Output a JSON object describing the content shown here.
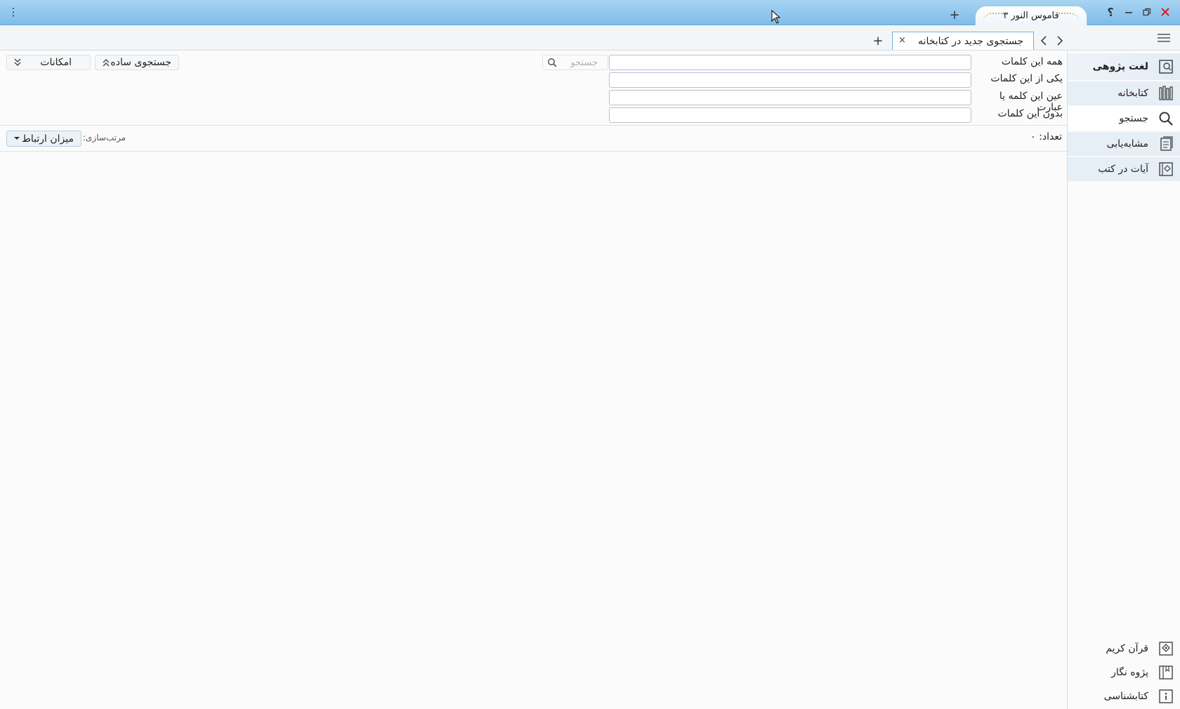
{
  "titlebar": {
    "app_tab_label": "قاموس النور ۳",
    "new_tab_symbol": "+",
    "help_symbol": "؟",
    "menu_symbol": "⋮"
  },
  "tabstrip": {
    "doc_tab_label": "جستجوی جدید در کتابخانه",
    "close_symbol": "×",
    "add_symbol": "+"
  },
  "sidebar": {
    "items": [
      {
        "label": "لغت پژوهی",
        "icon": "lexicon-icon"
      },
      {
        "label": "کتابخانه",
        "icon": "library-icon"
      },
      {
        "label": "جستجو",
        "icon": "search-icon"
      },
      {
        "label": "مشابه‌یابی",
        "icon": "similarity-icon"
      },
      {
        "label": "آیات در کتب",
        "icon": "verses-in-books-icon"
      }
    ],
    "bottom_items": [
      {
        "label": "قرآن کریم",
        "icon": "quran-icon"
      },
      {
        "label": "پژوه نگار",
        "icon": "notebook-icon"
      },
      {
        "label": "کتابشناسی",
        "icon": "info-icon"
      }
    ]
  },
  "search_form": {
    "rows": [
      {
        "label": "همه این کلمات",
        "value": ""
      },
      {
        "label": "یکی از این کلمات",
        "value": ""
      },
      {
        "label": "عین این کلمه یا عبارت",
        "value": ""
      },
      {
        "label": "بدون این کلمات",
        "value": ""
      }
    ],
    "search_placeholder": "جستجو",
    "simple_search_label": "جستجوی ساده",
    "options_label": "امکانات"
  },
  "results": {
    "count_label": "تعداد: ۰",
    "sort_label": "مرتب‌سازی:",
    "sort_value": "میزان ارتباط"
  }
}
